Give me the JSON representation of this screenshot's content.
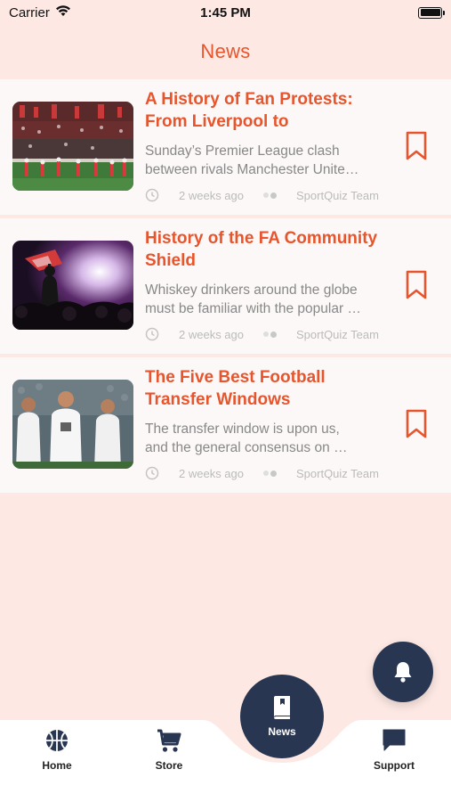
{
  "status_bar": {
    "carrier": "Carrier",
    "time": "1:45 PM",
    "battery_level": 1.0
  },
  "header": {
    "title": "News"
  },
  "articles": [
    {
      "title": "A History of Fan Protests: From Liverpool to",
      "excerpt_lines": [
        "Sunday’s Premier League clash",
        "between rivals Manchester Unite…"
      ],
      "time": "2 weeks ago",
      "author": "SportQuiz Team",
      "image": "stadium-crowd-photo"
    },
    {
      "title": "History of the FA Community Shield",
      "excerpt_lines": [
        "Whiskey drinkers around the globe",
        "must be familiar with the popular …"
      ],
      "time": "2 weeks ago",
      "author": "SportQuiz Team",
      "image": "concert-flag-photo"
    },
    {
      "title": "The Five Best Football Transfer Windows",
      "excerpt_lines": [
        "The transfer window is upon us,",
        "and the general consensus on …"
      ],
      "time": "2 weeks ago",
      "author": "SportQuiz Team",
      "image": "players-celebrating-photo"
    }
  ],
  "tabs": {
    "home": {
      "label": "Home",
      "icon": "basketball-icon"
    },
    "store": {
      "label": "Store",
      "icon": "cart-icon"
    },
    "news": {
      "label": "News",
      "icon": "book-icon",
      "active": true
    },
    "support": {
      "label": "Support",
      "icon": "chat-icon"
    }
  },
  "fab": {
    "icon": "bell-icon"
  },
  "colors": {
    "background": "#fde8e3",
    "accent": "#e8552c",
    "navy": "#293651",
    "card": "#fcf8f7",
    "muted": "#888888"
  }
}
